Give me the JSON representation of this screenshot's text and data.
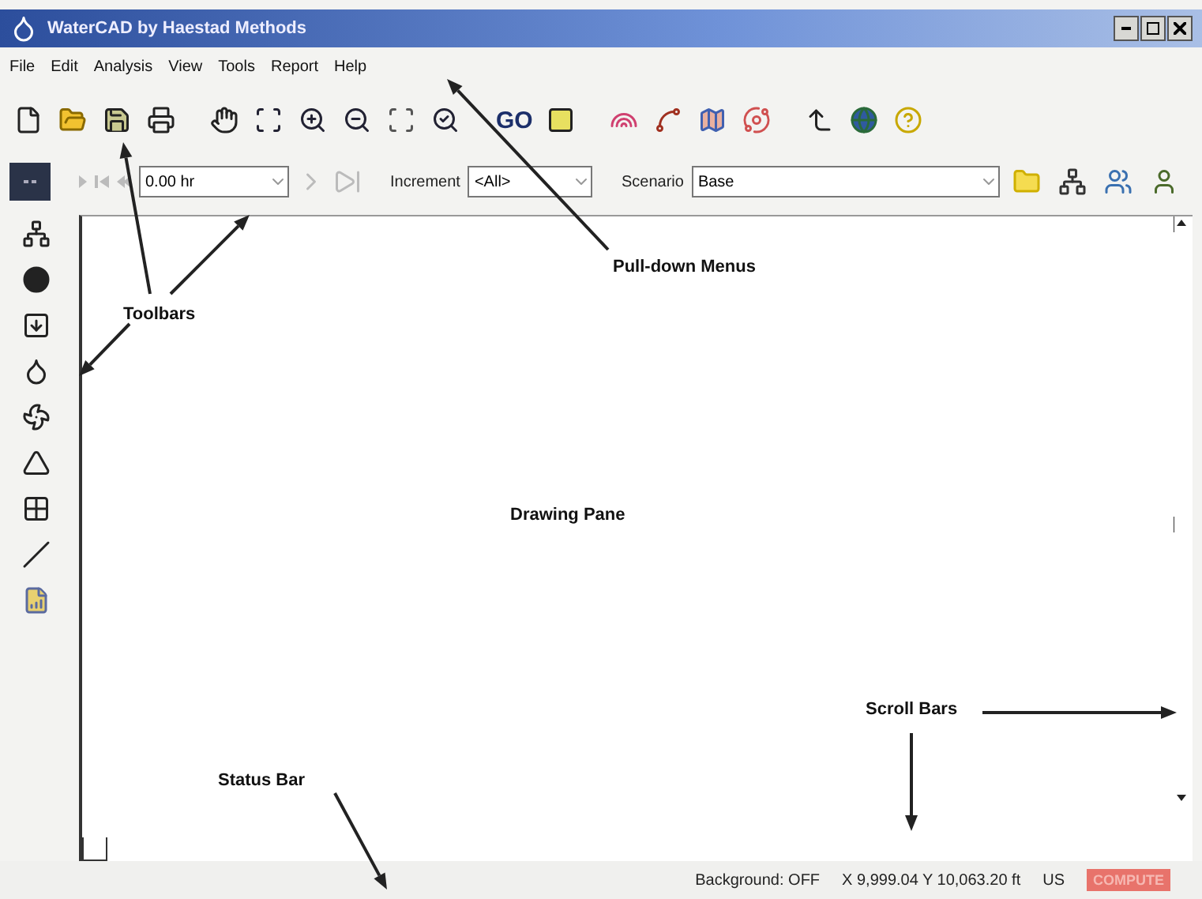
{
  "window": {
    "title": "WaterCAD by Haestad Methods"
  },
  "menus": [
    "File",
    "Edit",
    "Analysis",
    "View",
    "Tools",
    "Report",
    "Help"
  ],
  "toolbar": {
    "go_button": "GO"
  },
  "time_toolbar": {
    "time": "0.00 hr",
    "increment_label": "Increment",
    "increment": "<All>",
    "scenario_label": "Scenario",
    "scenario": "Base"
  },
  "status_bar": {
    "background": "Background: OFF",
    "coordinates": "X 9,999.04  Y 10,063.20 ft",
    "units": "US",
    "compute": "COMPUTE"
  },
  "annotations": [
    {
      "kind": "menus",
      "text": "Pull-down Menus"
    },
    {
      "kind": "toolbars",
      "text": "Toolbars"
    },
    {
      "kind": "pane",
      "text": "Drawing Pane"
    },
    {
      "kind": "status",
      "text": "Status Bar"
    },
    {
      "kind": "scroll",
      "text": "Scroll Bars"
    }
  ]
}
